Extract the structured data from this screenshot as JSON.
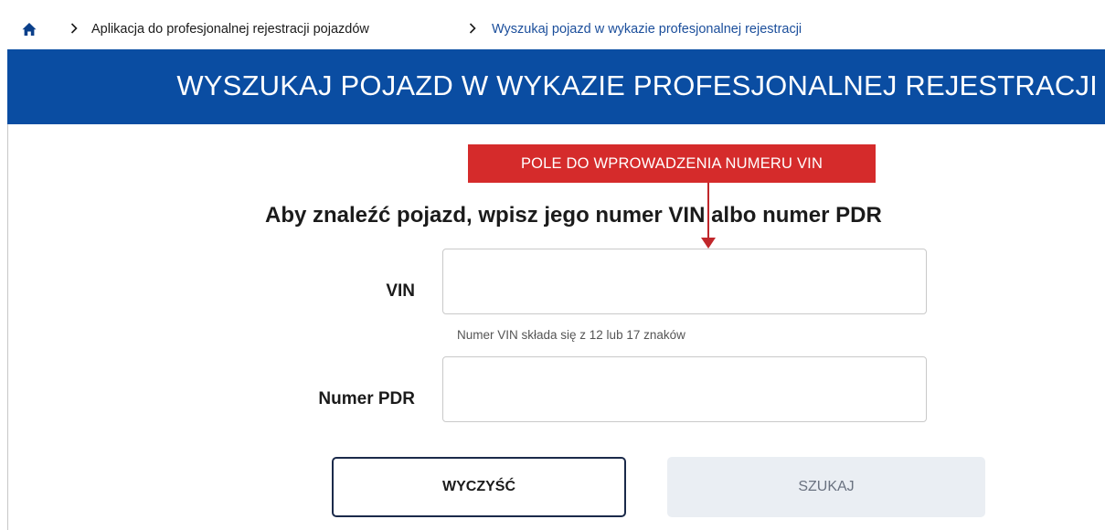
{
  "breadcrumb": {
    "home_icon": "home-icon",
    "items": [
      {
        "label": "Aplikacja do profesjonalnej rejestracji pojazdów"
      },
      {
        "label": "Wyszukaj pojazd w wykazie profesjonalnej rejestracji"
      }
    ]
  },
  "header": {
    "title": "WYSZUKAJ POJAZD W WYKAZIE PROFESJONALNEJ REJESTRACJI",
    "background_color": "#0a4da2"
  },
  "annotation": {
    "text": "POLE DO WPROWADZENIA NUMERU VIN",
    "color": "#d52b2b"
  },
  "form": {
    "instruction": "Aby znaleźć pojazd, wpisz jego numer VIN albo numer PDR",
    "vin": {
      "label": "VIN",
      "value": "",
      "placeholder": "",
      "hint": "Numer VIN składa się z 12 lub 17 znaków"
    },
    "pdr": {
      "label": "Numer PDR",
      "value": "",
      "placeholder": ""
    },
    "buttons": {
      "clear_label": "WYCZYŚĆ",
      "search_label": "SZUKAJ"
    }
  }
}
